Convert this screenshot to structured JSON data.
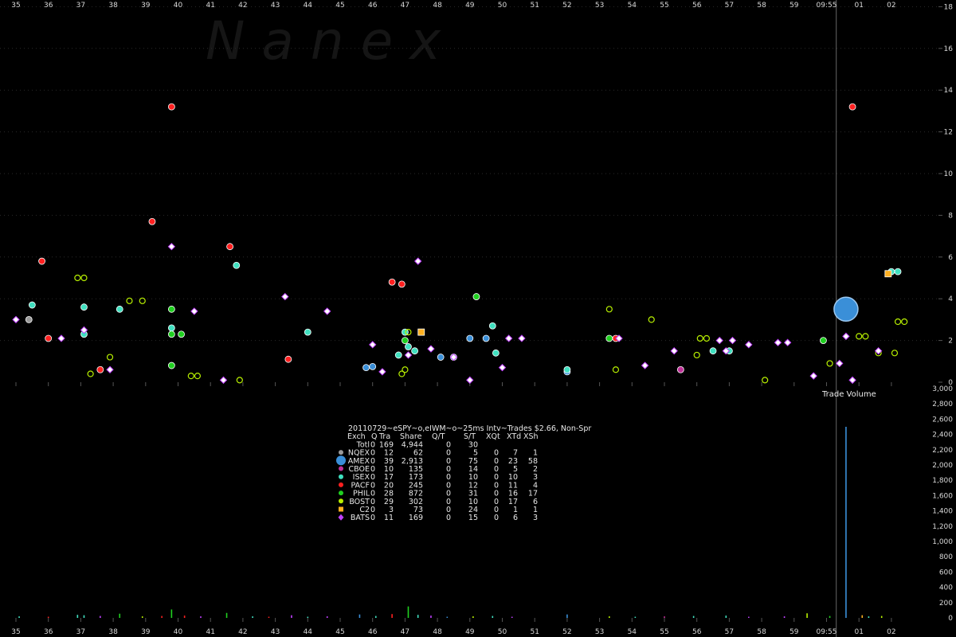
{
  "watermark": "N a n e x",
  "chart_data": [
    {
      "type": "scatter",
      "y_ticks": [
        "0",
        "2",
        "4",
        "6",
        "8",
        "10",
        "12",
        "14",
        "16",
        "18"
      ],
      "ylim": [
        0,
        18
      ],
      "x_labels": [
        "35",
        "36",
        "37",
        "38",
        "39",
        "40",
        "41",
        "42",
        "43",
        "44",
        "45",
        "46",
        "47",
        "48",
        "49",
        "50",
        "51",
        "52",
        "53",
        "54",
        "55",
        "56",
        "57",
        "58",
        "59",
        "09:55",
        "01",
        "02"
      ],
      "x_range_minutes": [
        35,
        62.6
      ],
      "marker_time_label": "09:55",
      "marker_time_minute": 60.3,
      "series": [
        {
          "name": "NQEX",
          "color": "#9a9a9a",
          "shape": "circle",
          "points": [
            [
              35.4,
              3.0
            ]
          ]
        },
        {
          "name": "AMEX",
          "color": "#3a8fd8",
          "shape": "circle",
          "points": [
            [
              45.8,
              0.7
            ],
            [
              46.0,
              0.75
            ],
            [
              48.1,
              1.2
            ],
            [
              48.5,
              1.2
            ],
            [
              49.0,
              2.1
            ],
            [
              49.5,
              2.1
            ],
            [
              52.0,
              0.5
            ],
            [
              60.6,
              3.5
            ]
          ]
        },
        {
          "name": "CBOE",
          "color": "#c03098",
          "shape": "circle",
          "points": [
            [
              55.5,
              0.6
            ]
          ]
        },
        {
          "name": "ISEX",
          "color": "#40e0c0",
          "shape": "circle",
          "points": [
            [
              35.5,
              3.7
            ],
            [
              37.1,
              3.6
            ],
            [
              37.1,
              2.3
            ],
            [
              38.2,
              3.5
            ],
            [
              39.8,
              2.6
            ],
            [
              41.8,
              5.6
            ],
            [
              44.0,
              2.4
            ],
            [
              46.8,
              1.3
            ],
            [
              47.0,
              2.4
            ],
            [
              47.1,
              1.7
            ],
            [
              47.3,
              1.5
            ],
            [
              49.7,
              2.7
            ],
            [
              49.8,
              1.4
            ],
            [
              52.0,
              0.6
            ],
            [
              56.5,
              1.5
            ],
            [
              57.0,
              1.5
            ],
            [
              62.0,
              5.3
            ],
            [
              62.2,
              5.3
            ]
          ]
        },
        {
          "name": "PACF",
          "color": "#ff2020",
          "shape": "circle",
          "points": [
            [
              35.8,
              5.8
            ],
            [
              36.0,
              2.1
            ],
            [
              37.6,
              0.6
            ],
            [
              39.2,
              7.7
            ],
            [
              39.8,
              13.2
            ],
            [
              41.6,
              6.5
            ],
            [
              43.4,
              1.1
            ],
            [
              46.6,
              4.8
            ],
            [
              46.9,
              4.7
            ],
            [
              53.5,
              2.1
            ],
            [
              60.8,
              13.2
            ]
          ]
        },
        {
          "name": "PHIL",
          "color": "#20d020",
          "shape": "circle",
          "points": [
            [
              39.8,
              3.5
            ],
            [
              39.8,
              2.3
            ],
            [
              40.1,
              2.3
            ],
            [
              39.8,
              0.8
            ],
            [
              47.0,
              2.0
            ],
            [
              49.2,
              4.1
            ],
            [
              53.3,
              2.1
            ],
            [
              59.9,
              2.0
            ]
          ]
        },
        {
          "name": "BOST",
          "color": "#b8f000",
          "shape": "ring",
          "points": [
            [
              36.9,
              5.0
            ],
            [
              37.1,
              5.0
            ],
            [
              38.5,
              3.9
            ],
            [
              38.9,
              3.9
            ],
            [
              37.9,
              1.2
            ],
            [
              37.3,
              0.4
            ],
            [
              40.4,
              0.3
            ],
            [
              40.6,
              0.3
            ],
            [
              41.9,
              0.1
            ],
            [
              46.9,
              0.4
            ],
            [
              47.0,
              0.6
            ],
            [
              47.1,
              2.4
            ],
            [
              53.3,
              3.5
            ],
            [
              53.5,
              0.6
            ],
            [
              54.6,
              3.0
            ],
            [
              56.0,
              1.3
            ],
            [
              56.1,
              2.1
            ],
            [
              56.3,
              2.1
            ],
            [
              58.1,
              0.1
            ],
            [
              60.1,
              0.9
            ],
            [
              61.0,
              2.2
            ],
            [
              61.2,
              2.2
            ],
            [
              61.6,
              1.4
            ],
            [
              62.1,
              1.4
            ],
            [
              62.2,
              2.9
            ],
            [
              62.4,
              2.9
            ]
          ]
        },
        {
          "name": "C2",
          "color": "#ffb020",
          "shape": "square",
          "points": [
            [
              47.5,
              2.4
            ],
            [
              61.9,
              5.2
            ]
          ]
        },
        {
          "name": "BATS",
          "color": "#c040ff",
          "shape": "diamond",
          "points": [
            [
              35.0,
              3.0
            ],
            [
              36.4,
              2.1
            ],
            [
              37.1,
              2.5
            ],
            [
              37.9,
              0.6
            ],
            [
              39.8,
              6.5
            ],
            [
              40.5,
              3.4
            ],
            [
              41.4,
              0.1
            ],
            [
              43.3,
              4.1
            ],
            [
              44.6,
              3.4
            ],
            [
              46.0,
              1.8
            ],
            [
              46.3,
              0.5
            ],
            [
              47.1,
              1.3
            ],
            [
              47.4,
              5.8
            ],
            [
              47.8,
              1.6
            ],
            [
              48.5,
              1.2
            ],
            [
              49.0,
              0.1
            ],
            [
              50.0,
              0.7
            ],
            [
              50.2,
              2.1
            ],
            [
              50.6,
              2.1
            ],
            [
              53.6,
              2.1
            ],
            [
              54.4,
              0.8
            ],
            [
              55.3,
              1.5
            ],
            [
              56.7,
              2.0
            ],
            [
              56.9,
              1.5
            ],
            [
              57.1,
              2.0
            ],
            [
              57.6,
              1.8
            ],
            [
              58.5,
              1.9
            ],
            [
              58.8,
              1.9
            ],
            [
              59.6,
              0.3
            ],
            [
              60.4,
              0.9
            ],
            [
              60.6,
              2.2
            ],
            [
              60.8,
              0.1
            ],
            [
              61.6,
              1.5
            ]
          ]
        }
      ],
      "annotation": "Trade Volume"
    },
    {
      "type": "bar",
      "y_ticks": [
        "0",
        "200",
        "400",
        "600",
        "800",
        "1,000",
        "1,200",
        "1,400",
        "1,600",
        "1,800",
        "2,000",
        "2,200",
        "2,400",
        "2,600",
        "2,800",
        "3,000"
      ],
      "ylim": [
        0,
        3000
      ],
      "bars": [
        {
          "x": 35.1,
          "value": 20,
          "color": "#40e0c0"
        },
        {
          "x": 36.0,
          "value": 15,
          "color": "#ff2020"
        },
        {
          "x": 36.9,
          "value": 40,
          "color": "#40e0c0"
        },
        {
          "x": 37.1,
          "value": 35,
          "color": "#40e0c0"
        },
        {
          "x": 37.6,
          "value": 25,
          "color": "#c040ff"
        },
        {
          "x": 38.2,
          "value": 55,
          "color": "#20d020"
        },
        {
          "x": 38.9,
          "value": 20,
          "color": "#b8f000"
        },
        {
          "x": 39.5,
          "value": 25,
          "color": "#ff2020"
        },
        {
          "x": 39.8,
          "value": 110,
          "color": "#20d020"
        },
        {
          "x": 40.2,
          "value": 30,
          "color": "#ff2020"
        },
        {
          "x": 40.7,
          "value": 20,
          "color": "#c040ff"
        },
        {
          "x": 41.5,
          "value": 65,
          "color": "#20d020"
        },
        {
          "x": 42.3,
          "value": 20,
          "color": "#40e0c0"
        },
        {
          "x": 42.8,
          "value": 15,
          "color": "#ff2020"
        },
        {
          "x": 43.5,
          "value": 35,
          "color": "#c040ff"
        },
        {
          "x": 44.0,
          "value": 15,
          "color": "#40e0c0"
        },
        {
          "x": 44.6,
          "value": 20,
          "color": "#c040ff"
        },
        {
          "x": 45.6,
          "value": 45,
          "color": "#3a8fd8"
        },
        {
          "x": 46.1,
          "value": 25,
          "color": "#40e0c0"
        },
        {
          "x": 46.6,
          "value": 50,
          "color": "#ff2020"
        },
        {
          "x": 47.1,
          "value": 150,
          "color": "#20d020"
        },
        {
          "x": 47.4,
          "value": 40,
          "color": "#40e0c0"
        },
        {
          "x": 47.8,
          "value": 30,
          "color": "#c040ff"
        },
        {
          "x": 48.3,
          "value": 15,
          "color": "#3a8fd8"
        },
        {
          "x": 49.1,
          "value": 20,
          "color": "#b8f000"
        },
        {
          "x": 49.7,
          "value": 25,
          "color": "#40e0c0"
        },
        {
          "x": 50.3,
          "value": 15,
          "color": "#c040ff"
        },
        {
          "x": 52.0,
          "value": 45,
          "color": "#3a8fd8"
        },
        {
          "x": 53.3,
          "value": 20,
          "color": "#b8f000"
        },
        {
          "x": 54.1,
          "value": 15,
          "color": "#40e0c0"
        },
        {
          "x": 55.0,
          "value": 20,
          "color": "#c03098"
        },
        {
          "x": 55.9,
          "value": 25,
          "color": "#40e0c0"
        },
        {
          "x": 56.9,
          "value": 30,
          "color": "#40e0c0"
        },
        {
          "x": 57.6,
          "value": 15,
          "color": "#c040ff"
        },
        {
          "x": 58.7,
          "value": 20,
          "color": "#c040ff"
        },
        {
          "x": 59.4,
          "value": 60,
          "color": "#b8f000"
        },
        {
          "x": 60.1,
          "value": 25,
          "color": "#20d020"
        },
        {
          "x": 60.6,
          "value": 2500,
          "color": "#3a8fd8"
        },
        {
          "x": 61.1,
          "value": 35,
          "color": "#ffb020"
        },
        {
          "x": 61.3,
          "value": 20,
          "color": "#40e0c0"
        },
        {
          "x": 61.7,
          "value": 25,
          "color": "#b8f000"
        }
      ]
    }
  ],
  "stats_table": {
    "title": "20110729~eSPY~o,eIWM~o~25ms Intv~Trades $2.66, Non-Spr",
    "headers": [
      "Exch",
      "Q",
      "Tra",
      "Share",
      "Q/T",
      "S/T",
      "XQt",
      "XTd",
      "XSh"
    ],
    "rows": [
      {
        "icon": "none",
        "color": "",
        "cells": [
          "Totl",
          "0",
          "169",
          "4,944",
          "0",
          "30",
          "",
          "",
          ""
        ]
      },
      {
        "icon": "circle",
        "color": "#9a9a9a",
        "cells": [
          "NQEX",
          "0",
          "12",
          "62",
          "0",
          "5",
          "0",
          "7",
          "1"
        ]
      },
      {
        "icon": "circle",
        "color": "#3a8fd8",
        "cells": [
          "AMEX",
          "0",
          "39",
          "2,913",
          "0",
          "75",
          "0",
          "23",
          "58"
        ]
      },
      {
        "icon": "circle",
        "color": "#c03098",
        "cells": [
          "CBOE",
          "0",
          "10",
          "135",
          "0",
          "14",
          "0",
          "5",
          "2"
        ]
      },
      {
        "icon": "circle",
        "color": "#40e0c0",
        "cells": [
          "ISEX",
          "0",
          "17",
          "173",
          "0",
          "10",
          "0",
          "10",
          "3"
        ]
      },
      {
        "icon": "circle",
        "color": "#ff2020",
        "cells": [
          "PACF",
          "0",
          "20",
          "245",
          "0",
          "12",
          "0",
          "11",
          "4"
        ]
      },
      {
        "icon": "circle",
        "color": "#20d020",
        "cells": [
          "PHIL",
          "0",
          "28",
          "872",
          "0",
          "31",
          "0",
          "16",
          "17"
        ]
      },
      {
        "icon": "circle",
        "color": "#b8f000",
        "cells": [
          "BOST",
          "0",
          "29",
          "302",
          "0",
          "10",
          "0",
          "17",
          "6"
        ]
      },
      {
        "icon": "square",
        "color": "#ffb020",
        "cells": [
          "C2",
          "0",
          "3",
          "73",
          "0",
          "24",
          "0",
          "1",
          "1"
        ]
      },
      {
        "icon": "diamond",
        "color": "#c040ff",
        "cells": [
          "BATS",
          "0",
          "11",
          "169",
          "0",
          "15",
          "0",
          "6",
          "3"
        ]
      }
    ]
  }
}
